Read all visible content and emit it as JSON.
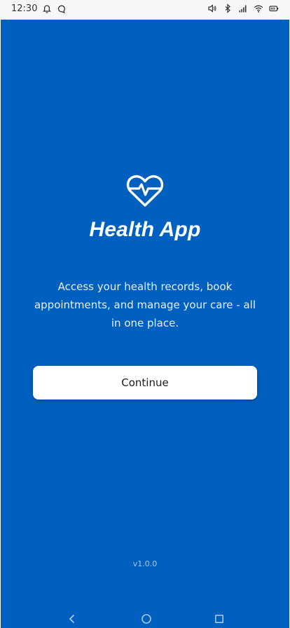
{
  "status_bar": {
    "time": "12:30",
    "left_icons": [
      "bell-icon",
      "chat-bubble-icon"
    ],
    "right_icons": [
      "volume-icon",
      "bluetooth-icon",
      "signal-icon",
      "wifi-icon",
      "battery-icon"
    ]
  },
  "app": {
    "logo_icon": "heart-pulse-icon",
    "title": "Health App",
    "tagline": "Access your health records, book appointments, and manage your care - all in one place.",
    "continue_label": "Continue",
    "version": "v1.0.0"
  },
  "nav_bar": {
    "buttons": [
      "back-icon",
      "home-icon",
      "recents-icon"
    ]
  },
  "colors": {
    "background": "#0060c0",
    "button": "#ffffff",
    "status_bar": "#f7f7f7"
  }
}
